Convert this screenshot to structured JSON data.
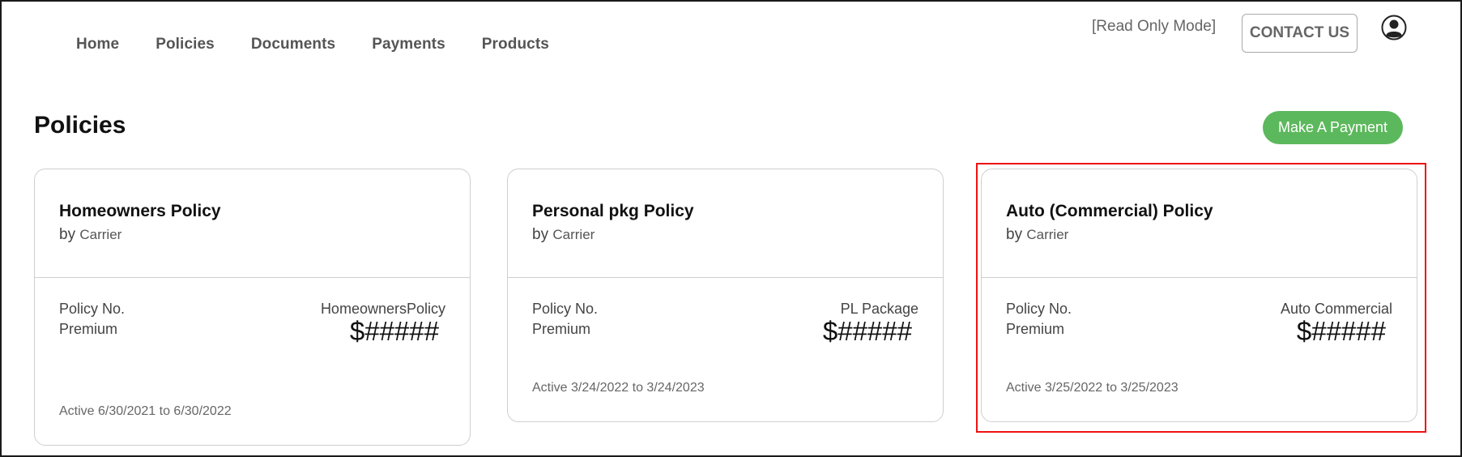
{
  "nav": {
    "items": [
      {
        "label": "Home"
      },
      {
        "label": "Policies"
      },
      {
        "label": "Documents"
      },
      {
        "label": "Payments"
      },
      {
        "label": "Products"
      }
    ],
    "read_only_label": "[Read Only Mode]",
    "contact_label": "CONTACT US",
    "user_icon": "user-circle-icon"
  },
  "page": {
    "title": "Policies",
    "make_payment_label": "Make A Payment"
  },
  "policies": [
    {
      "name": "Homeowners Policy",
      "by_label": "by",
      "carrier": "Carrier",
      "policy_no_label": "Policy No.",
      "policy_no_value": "HomeownersPolicy",
      "premium_label": "Premium",
      "premium_value": "$#####",
      "active_text": "Active 6/30/2021 to 6/30/2022"
    },
    {
      "name": "Personal pkg Policy",
      "by_label": "by",
      "carrier": "Carrier",
      "policy_no_label": "Policy No.",
      "policy_no_value": "PL Package",
      "premium_label": "Premium",
      "premium_value": "$#####",
      "active_text": "Active 3/24/2022 to 3/24/2023"
    },
    {
      "name": "Auto (Commercial) Policy",
      "by_label": "by",
      "carrier": "Carrier",
      "policy_no_label": "Policy No.",
      "policy_no_value": "Auto Commercial",
      "premium_label": "Premium",
      "premium_value": "$#####",
      "active_text": "Active 3/25/2022 to 3/25/2023"
    }
  ],
  "colors": {
    "accent_green": "#5cb85c",
    "highlight_red": "#ee1111"
  }
}
